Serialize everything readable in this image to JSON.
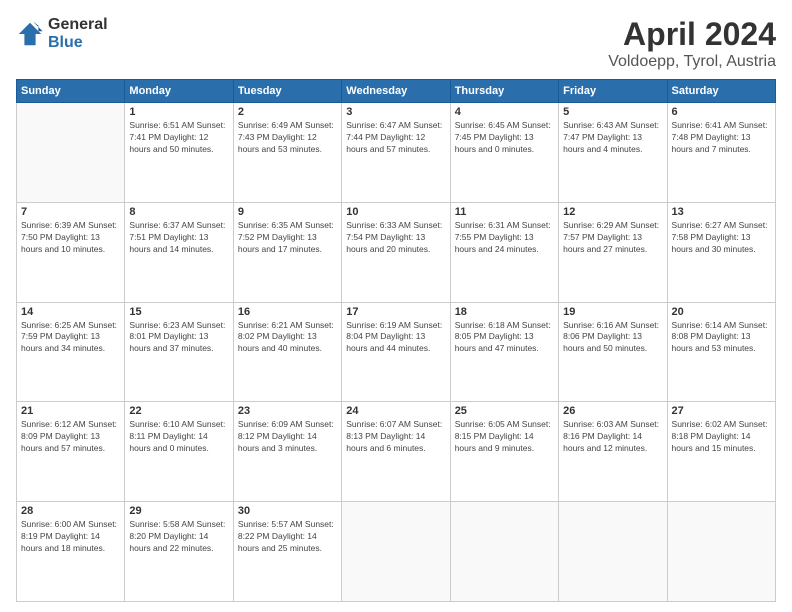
{
  "logo": {
    "general": "General",
    "blue": "Blue"
  },
  "header": {
    "title": "April 2024",
    "subtitle": "Voldoepp, Tyrol, Austria"
  },
  "weekdays": [
    "Sunday",
    "Monday",
    "Tuesday",
    "Wednesday",
    "Thursday",
    "Friday",
    "Saturday"
  ],
  "weeks": [
    [
      {
        "day": "",
        "info": ""
      },
      {
        "day": "1",
        "info": "Sunrise: 6:51 AM\nSunset: 7:41 PM\nDaylight: 12 hours\nand 50 minutes."
      },
      {
        "day": "2",
        "info": "Sunrise: 6:49 AM\nSunset: 7:43 PM\nDaylight: 12 hours\nand 53 minutes."
      },
      {
        "day": "3",
        "info": "Sunrise: 6:47 AM\nSunset: 7:44 PM\nDaylight: 12 hours\nand 57 minutes."
      },
      {
        "day": "4",
        "info": "Sunrise: 6:45 AM\nSunset: 7:45 PM\nDaylight: 13 hours\nand 0 minutes."
      },
      {
        "day": "5",
        "info": "Sunrise: 6:43 AM\nSunset: 7:47 PM\nDaylight: 13 hours\nand 4 minutes."
      },
      {
        "day": "6",
        "info": "Sunrise: 6:41 AM\nSunset: 7:48 PM\nDaylight: 13 hours\nand 7 minutes."
      }
    ],
    [
      {
        "day": "7",
        "info": "Sunrise: 6:39 AM\nSunset: 7:50 PM\nDaylight: 13 hours\nand 10 minutes."
      },
      {
        "day": "8",
        "info": "Sunrise: 6:37 AM\nSunset: 7:51 PM\nDaylight: 13 hours\nand 14 minutes."
      },
      {
        "day": "9",
        "info": "Sunrise: 6:35 AM\nSunset: 7:52 PM\nDaylight: 13 hours\nand 17 minutes."
      },
      {
        "day": "10",
        "info": "Sunrise: 6:33 AM\nSunset: 7:54 PM\nDaylight: 13 hours\nand 20 minutes."
      },
      {
        "day": "11",
        "info": "Sunrise: 6:31 AM\nSunset: 7:55 PM\nDaylight: 13 hours\nand 24 minutes."
      },
      {
        "day": "12",
        "info": "Sunrise: 6:29 AM\nSunset: 7:57 PM\nDaylight: 13 hours\nand 27 minutes."
      },
      {
        "day": "13",
        "info": "Sunrise: 6:27 AM\nSunset: 7:58 PM\nDaylight: 13 hours\nand 30 minutes."
      }
    ],
    [
      {
        "day": "14",
        "info": "Sunrise: 6:25 AM\nSunset: 7:59 PM\nDaylight: 13 hours\nand 34 minutes."
      },
      {
        "day": "15",
        "info": "Sunrise: 6:23 AM\nSunset: 8:01 PM\nDaylight: 13 hours\nand 37 minutes."
      },
      {
        "day": "16",
        "info": "Sunrise: 6:21 AM\nSunset: 8:02 PM\nDaylight: 13 hours\nand 40 minutes."
      },
      {
        "day": "17",
        "info": "Sunrise: 6:19 AM\nSunset: 8:04 PM\nDaylight: 13 hours\nand 44 minutes."
      },
      {
        "day": "18",
        "info": "Sunrise: 6:18 AM\nSunset: 8:05 PM\nDaylight: 13 hours\nand 47 minutes."
      },
      {
        "day": "19",
        "info": "Sunrise: 6:16 AM\nSunset: 8:06 PM\nDaylight: 13 hours\nand 50 minutes."
      },
      {
        "day": "20",
        "info": "Sunrise: 6:14 AM\nSunset: 8:08 PM\nDaylight: 13 hours\nand 53 minutes."
      }
    ],
    [
      {
        "day": "21",
        "info": "Sunrise: 6:12 AM\nSunset: 8:09 PM\nDaylight: 13 hours\nand 57 minutes."
      },
      {
        "day": "22",
        "info": "Sunrise: 6:10 AM\nSunset: 8:11 PM\nDaylight: 14 hours\nand 0 minutes."
      },
      {
        "day": "23",
        "info": "Sunrise: 6:09 AM\nSunset: 8:12 PM\nDaylight: 14 hours\nand 3 minutes."
      },
      {
        "day": "24",
        "info": "Sunrise: 6:07 AM\nSunset: 8:13 PM\nDaylight: 14 hours\nand 6 minutes."
      },
      {
        "day": "25",
        "info": "Sunrise: 6:05 AM\nSunset: 8:15 PM\nDaylight: 14 hours\nand 9 minutes."
      },
      {
        "day": "26",
        "info": "Sunrise: 6:03 AM\nSunset: 8:16 PM\nDaylight: 14 hours\nand 12 minutes."
      },
      {
        "day": "27",
        "info": "Sunrise: 6:02 AM\nSunset: 8:18 PM\nDaylight: 14 hours\nand 15 minutes."
      }
    ],
    [
      {
        "day": "28",
        "info": "Sunrise: 6:00 AM\nSunset: 8:19 PM\nDaylight: 14 hours\nand 18 minutes."
      },
      {
        "day": "29",
        "info": "Sunrise: 5:58 AM\nSunset: 8:20 PM\nDaylight: 14 hours\nand 22 minutes."
      },
      {
        "day": "30",
        "info": "Sunrise: 5:57 AM\nSunset: 8:22 PM\nDaylight: 14 hours\nand 25 minutes."
      },
      {
        "day": "",
        "info": ""
      },
      {
        "day": "",
        "info": ""
      },
      {
        "day": "",
        "info": ""
      },
      {
        "day": "",
        "info": ""
      }
    ]
  ]
}
